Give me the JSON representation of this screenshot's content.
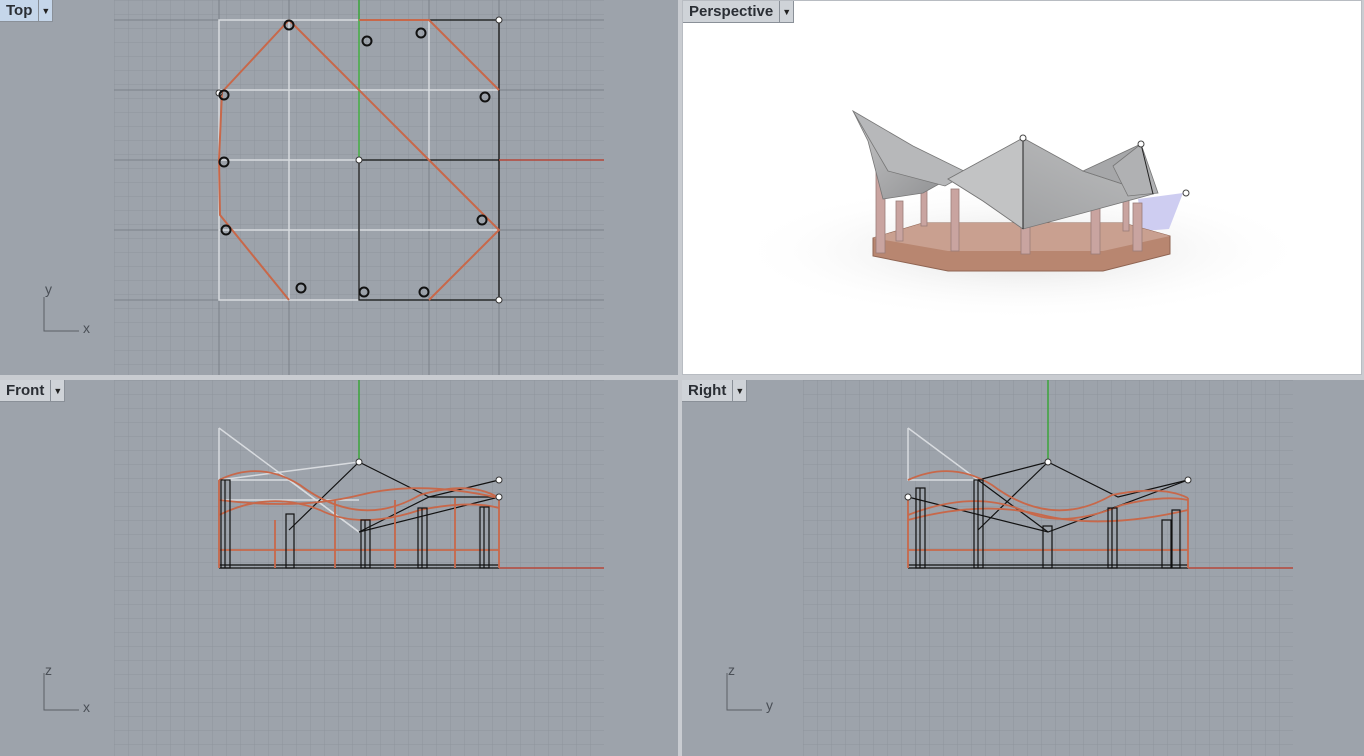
{
  "viewports": {
    "top": {
      "label": "Top",
      "axis_h": "x",
      "axis_v": "y",
      "active": true
    },
    "persp": {
      "label": "Perspective"
    },
    "front": {
      "label": "Front",
      "axis_h": "x",
      "axis_v": "z"
    },
    "right": {
      "label": "Right",
      "axis_h": "y",
      "axis_v": "z"
    }
  },
  "icons": {
    "dropdown": "chevron-down-icon"
  },
  "colors": {
    "viewport_bg": "#9da3ab",
    "grid_minor": "#8e949c",
    "grid_major": "#7b8189",
    "curve_orange": "#c8684a",
    "control_white": "#d8dbdf",
    "y_axis_green": "#3aa53a",
    "x_axis_red": "#b5483a",
    "perspective_bg": "#ffffff",
    "roof_gray": "#a9aaac",
    "column_pink": "#c9a4a0",
    "base_brown": "#b88670"
  }
}
